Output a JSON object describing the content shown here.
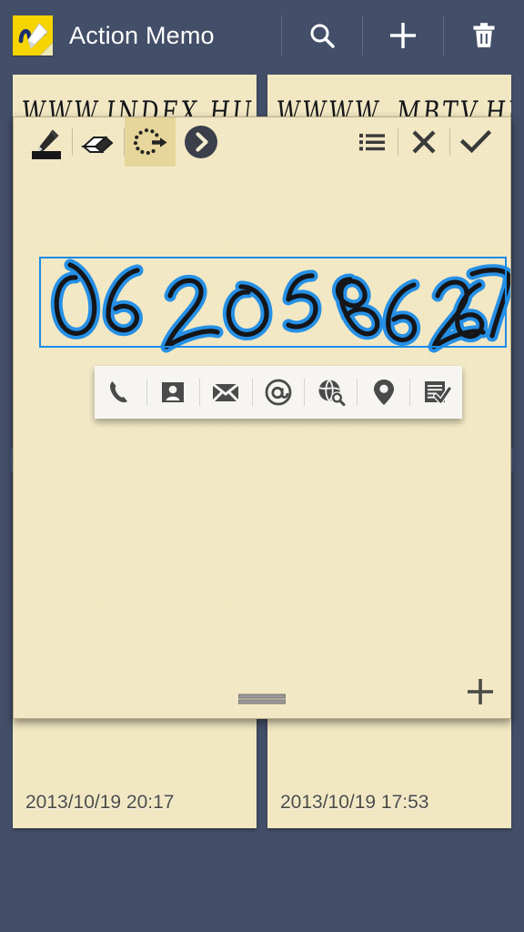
{
  "app": {
    "title": "Action Memo",
    "icon": "action-memo-app-icon",
    "background_color": "#434f68",
    "paper_color": "#f3e9c4",
    "accent_blue": "#1b8ce8",
    "highlight_color": "#e6d69b"
  },
  "header": {
    "actions": [
      {
        "name": "search-icon",
        "label": "Search"
      },
      {
        "name": "add-icon",
        "label": "New memo"
      },
      {
        "name": "trash-icon",
        "label": "Delete"
      }
    ]
  },
  "memo_list": [
    {
      "ink_text": "WWW.INDEX.HU",
      "date": "2013/10/19 20:17"
    },
    {
      "ink_text": "WWWW. MBTV.HU",
      "date": "2013/10/19 17:53"
    }
  ],
  "editor": {
    "toolbar": {
      "left_tools": [
        {
          "name": "pen-tool",
          "label": "Pen",
          "selected": false,
          "swatch_color": "#16171b"
        },
        {
          "name": "eraser-tool",
          "label": "Eraser",
          "selected": false
        },
        {
          "name": "selection-tool",
          "label": "Select",
          "selected": true
        },
        {
          "name": "more-actions-button",
          "label": "More",
          "selected": false
        }
      ],
      "right_tools": [
        {
          "name": "list-view-button",
          "label": "List"
        },
        {
          "name": "cancel-button",
          "label": "Cancel"
        },
        {
          "name": "confirm-button",
          "label": "Done"
        }
      ]
    },
    "handwriting": {
      "recognized_text": "0620 586 267",
      "ink_color": "#15161a",
      "selection_glow_color": "#1b8ce8",
      "selected": true
    },
    "action_popup": {
      "items": [
        {
          "name": "call-icon",
          "label": "Call"
        },
        {
          "name": "contact-icon",
          "label": "Add to contacts"
        },
        {
          "name": "message-icon",
          "label": "Send message"
        },
        {
          "name": "email-icon",
          "label": "Send email"
        },
        {
          "name": "web-search-icon",
          "label": "Search the web"
        },
        {
          "name": "map-icon",
          "label": "Find on map"
        },
        {
          "name": "task-icon",
          "label": "Create task"
        }
      ]
    },
    "footer": {
      "drag_handle": "resize-handle",
      "add_page": "add-page-icon"
    }
  }
}
